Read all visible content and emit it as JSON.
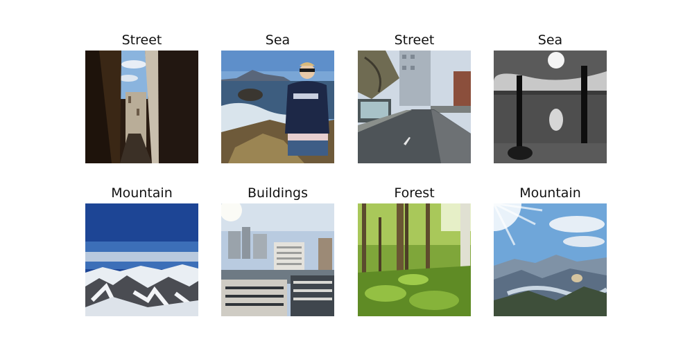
{
  "figure": {
    "panels": [
      {
        "label": "Street",
        "scene": "street-alley"
      },
      {
        "label": "Sea",
        "scene": "sea-person"
      },
      {
        "label": "Street",
        "scene": "street-road"
      },
      {
        "label": "Sea",
        "scene": "sea-bw"
      },
      {
        "label": "Mountain",
        "scene": "mountain-snow"
      },
      {
        "label": "Buildings",
        "scene": "buildings-city"
      },
      {
        "label": "Forest",
        "scene": "forest-green"
      },
      {
        "label": "Mountain",
        "scene": "mountain-sun"
      }
    ]
  }
}
